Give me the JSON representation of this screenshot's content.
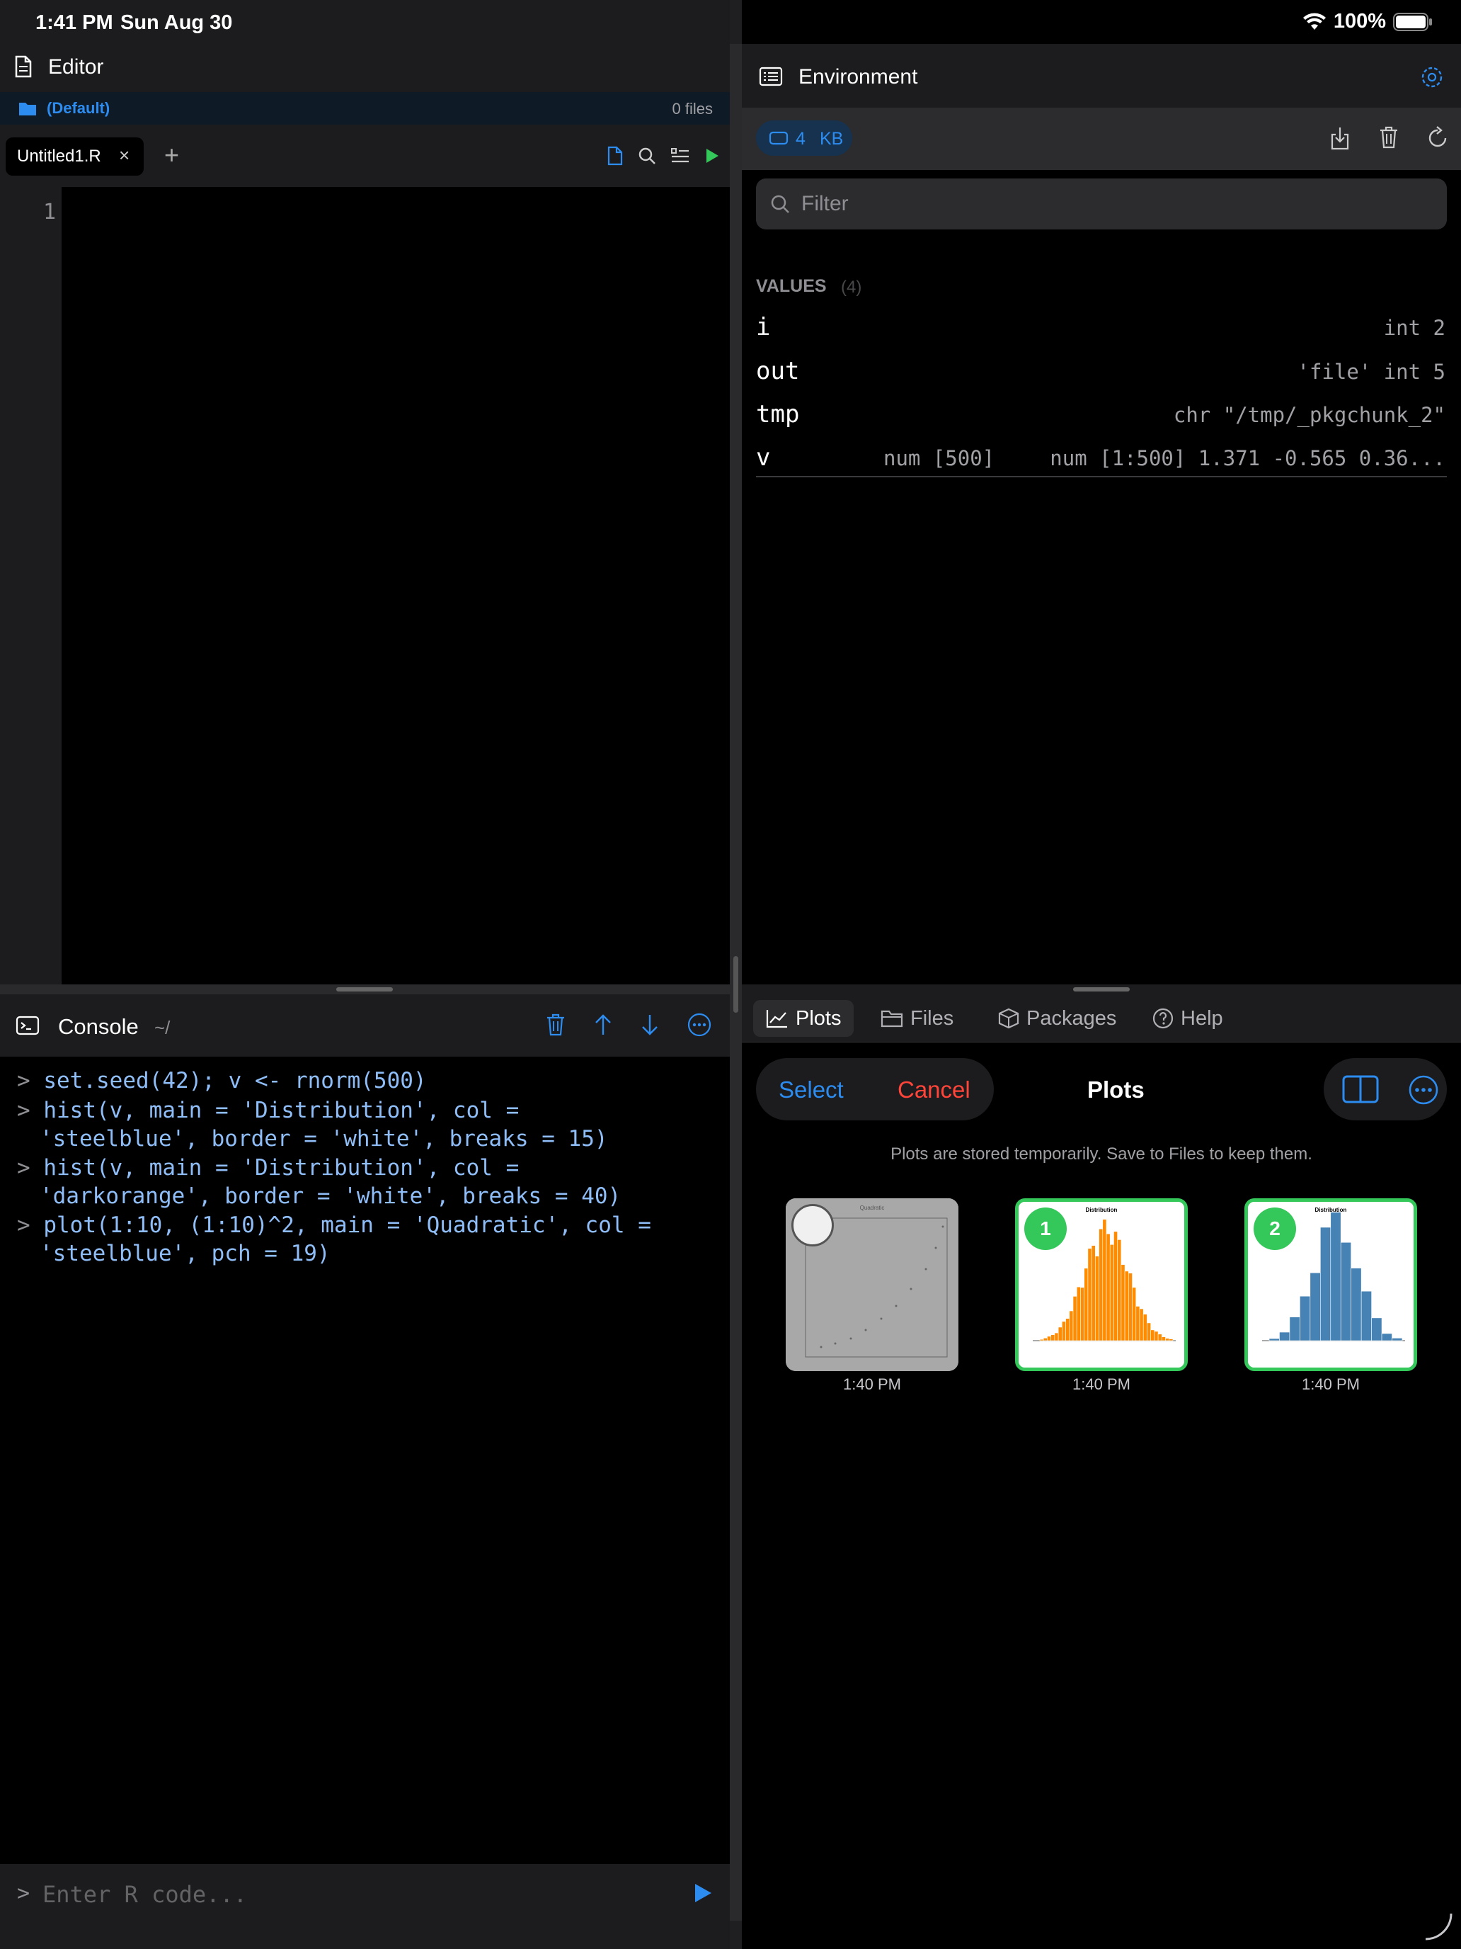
{
  "status_bar": {
    "time": "1:41 PM",
    "date": "Sun Aug 30",
    "battery": "100%"
  },
  "editor": {
    "title": "Editor",
    "project": "(Default)",
    "file_count": "0 files",
    "tab_label": "Untitled1.R",
    "tab_close": "×",
    "add_tab": "+",
    "line_number": "1"
  },
  "console": {
    "title": "Console",
    "path": "~/",
    "prompt": ">",
    "lines": [
      {
        "prompt": ">",
        "text": "set.seed(42); v <- rnorm(500)"
      },
      {
        "prompt": ">",
        "text": "hist(v, main = 'Distribution', col ="
      },
      {
        "prompt": "",
        "text": "'steelblue', border = 'white', breaks = 15)"
      },
      {
        "prompt": ">",
        "text": "hist(v, main = 'Distribution', col ="
      },
      {
        "prompt": "",
        "text": "'darkorange', border = 'white', breaks = 40)"
      },
      {
        "prompt": ">",
        "text": "plot(1:10, (1:10)^2, main = 'Quadratic', col ="
      },
      {
        "prompt": "",
        "text": "'steelblue', pch = 19)"
      }
    ],
    "input_placeholder": "Enter R code..."
  },
  "environment": {
    "title": "Environment",
    "memory_value": "4",
    "memory_unit": "KB",
    "filter_placeholder": "Filter",
    "values_label": "VALUES",
    "values_count": "(4)",
    "variables": [
      {
        "name": "i",
        "type": "",
        "value": "int 2"
      },
      {
        "name": "out",
        "type": "",
        "value": "'file' int 5"
      },
      {
        "name": "tmp",
        "type": "",
        "value": "chr \"/tmp/_pkgchunk_2\""
      },
      {
        "name": "v",
        "type": "num [500]",
        "value": "num [1:500] 1.371 -0.565 0.36..."
      }
    ]
  },
  "plots_panel": {
    "tabs": [
      {
        "label": "Plots",
        "icon": "chart-line-icon",
        "active": true
      },
      {
        "label": "Files",
        "icon": "folder-icon",
        "active": false
      },
      {
        "label": "Packages",
        "icon": "package-icon",
        "active": false
      },
      {
        "label": "Help",
        "icon": "help-icon",
        "active": false
      }
    ],
    "select_label": "Select",
    "cancel_label": "Cancel",
    "title": "Plots",
    "notice": "Plots are stored temporarily. Save to Files to keep them.",
    "thumbnails": [
      {
        "title": "Quadratic",
        "time": "1:40 PM",
        "selected": false,
        "badge": ""
      },
      {
        "title": "Distribution",
        "time": "1:40 PM",
        "selected": true,
        "badge": "1"
      },
      {
        "title": "Distribution",
        "time": "1:40 PM",
        "selected": true,
        "badge": "2"
      }
    ]
  },
  "colors": {
    "accent": "#2d8cf0",
    "danger": "#ff453a",
    "selection": "#34c759",
    "console_text": "#8fbdf7",
    "orange_bars": "#ff8c00",
    "blue_bars": "#4682b4"
  }
}
